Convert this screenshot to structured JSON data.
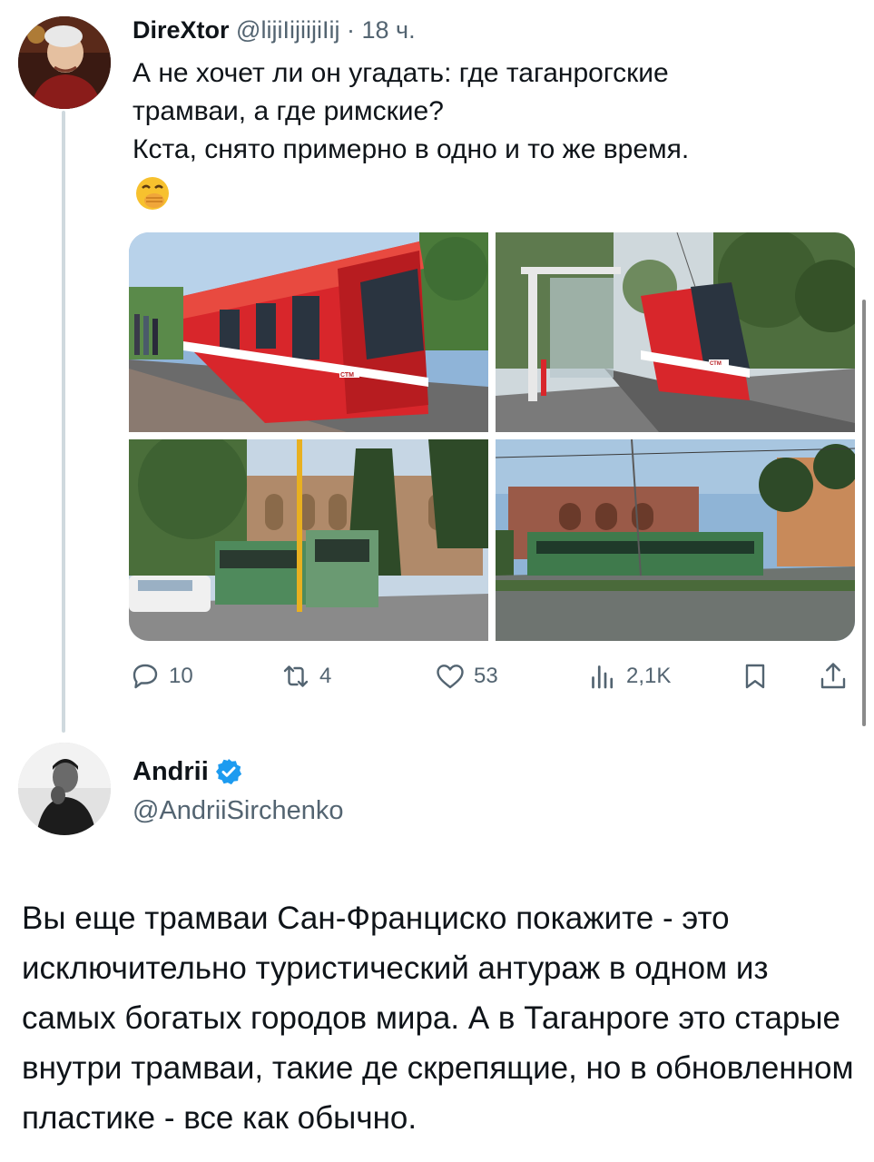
{
  "tweet1": {
    "author_name": "DireXtor",
    "author_handle": "@lijiIijiijiIij",
    "separator": "·",
    "time": "18 ч.",
    "text_lines": [
      "А не хочет ли он угадать: где таганрогские",
      "трамваи, а где римские?",
      "Кста, снято примерно в одно и то же время."
    ],
    "emoji_name": "face-with-hand-over-mouth",
    "photos": [
      {
        "name": "red-tram-platform-photo",
        "sign_text": "СТМ"
      },
      {
        "name": "red-tram-stop-photo",
        "sign_text": "СТМ"
      },
      {
        "name": "green-tram-rome-arches-photo"
      },
      {
        "name": "green-tram-rome-ruins-photo"
      }
    ],
    "actions": {
      "reply_count": "10",
      "retweet_count": "4",
      "like_count": "53",
      "views_count": "2,1K"
    }
  },
  "tweet2": {
    "author_name": "Andrii",
    "author_handle": "@AndriiSirchenko",
    "verified": true,
    "text": "Вы еще трамваи Сан-Франциско покажите - это исключительно туристический антураж в одном из самых богатых городов мира. А в Таганроге это старые внутри трамваи, такие де скрепящие, но в обновленном пластике - все как обычно."
  },
  "colors": {
    "text_primary": "#0f1419",
    "text_secondary": "#536471",
    "verified_blue": "#1d9bf0",
    "thread_line": "#cfd9de",
    "tram_red": "#d8262b",
    "tram_green": "#4f8a5c"
  }
}
